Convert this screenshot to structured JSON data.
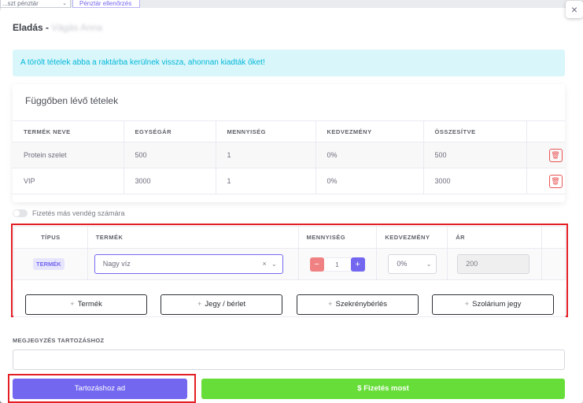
{
  "background": {
    "select_text": "...szt pénztár",
    "check_button": "Pénztár ellenőrzés"
  },
  "modal": {
    "title": "Eladás -",
    "title_blurred": "Vágás Anna",
    "close_icon": "×"
  },
  "alert": {
    "text": "A törölt tételek abba a raktárba kerülnek vissza, ahonnan kiadták őket!"
  },
  "pending": {
    "title": "Függőben lévő tételek",
    "headers": [
      "TERMÉK NEVE",
      "EGYSÉGÁR",
      "MENNYISÉG",
      "KEDVEZMÉNY",
      "ÖSSZESÍTVE",
      ""
    ],
    "rows": [
      {
        "name": "Protein szelet",
        "unit_price": "500",
        "qty": "1",
        "discount": "0%",
        "total": "500"
      },
      {
        "name": "VIP",
        "unit_price": "3000",
        "qty": "1",
        "discount": "0%",
        "total": "3000"
      }
    ]
  },
  "guest_toggle": {
    "label": "Fizetés más vendég számára"
  },
  "items": {
    "headers": [
      "TÍPUS",
      "TERMÉK",
      "MENNYISÉG",
      "KEDVEZMÉNY",
      "ÁR",
      ""
    ],
    "row": {
      "type": "TERMÉK",
      "product": "Nagy víz",
      "qty": "1",
      "discount": "0%",
      "price": "200"
    },
    "add_buttons": [
      "Termék",
      "Jegy / bérlet",
      "Szekrénybérlés",
      "Szolárium jegy"
    ]
  },
  "note": {
    "label": "MEGJEGYZÉS TARTOZÁSHOZ",
    "value": ""
  },
  "actions": {
    "add_to_debt": "Tartozáshoz ad",
    "pay_now": "$ Fizetés most"
  },
  "colors": {
    "primary": "#7367f0",
    "success": "#67dd3a",
    "danger": "#ea5455",
    "info_bg": "#d9f6fa",
    "info_text": "#00b8d9",
    "highlight": "#e31e24"
  }
}
